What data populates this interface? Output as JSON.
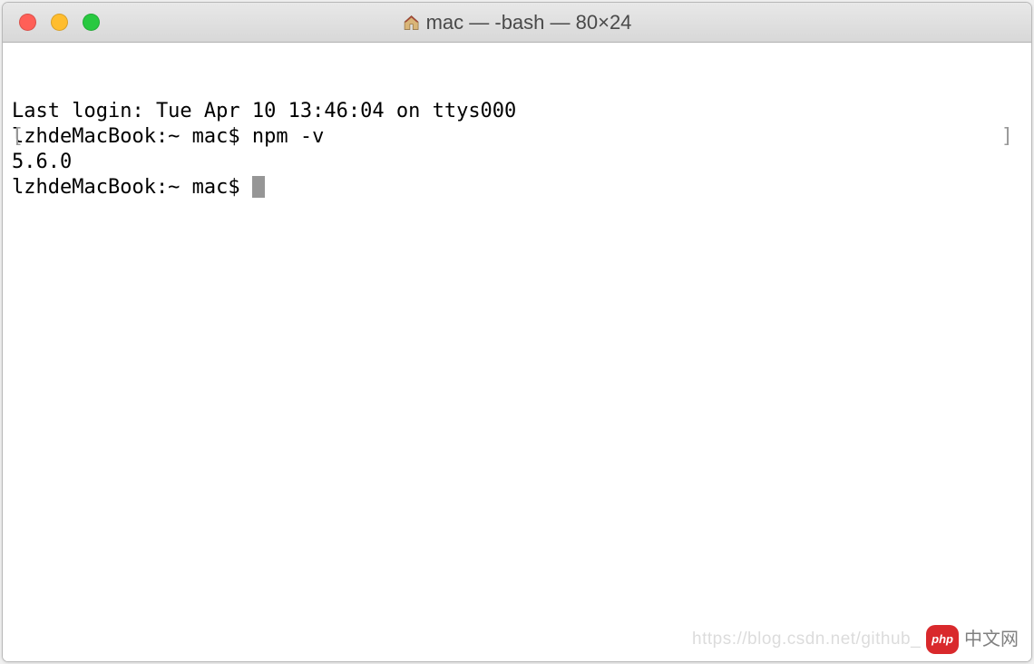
{
  "window": {
    "title": "mac — -bash — 80×24"
  },
  "terminal": {
    "last_login": "Last login: Tue Apr 10 13:46:04 on ttys000",
    "prompt1": "lzhdeMacBook:~ mac$ ",
    "command1": "npm -v",
    "output1": "5.6.0",
    "prompt2": "lzhdeMacBook:~ mac$ ",
    "bracket_left": "[",
    "bracket_right": "]"
  },
  "watermark": {
    "url": "https://blog.csdn.net/github_",
    "badge": "php",
    "cn": "中文网"
  }
}
